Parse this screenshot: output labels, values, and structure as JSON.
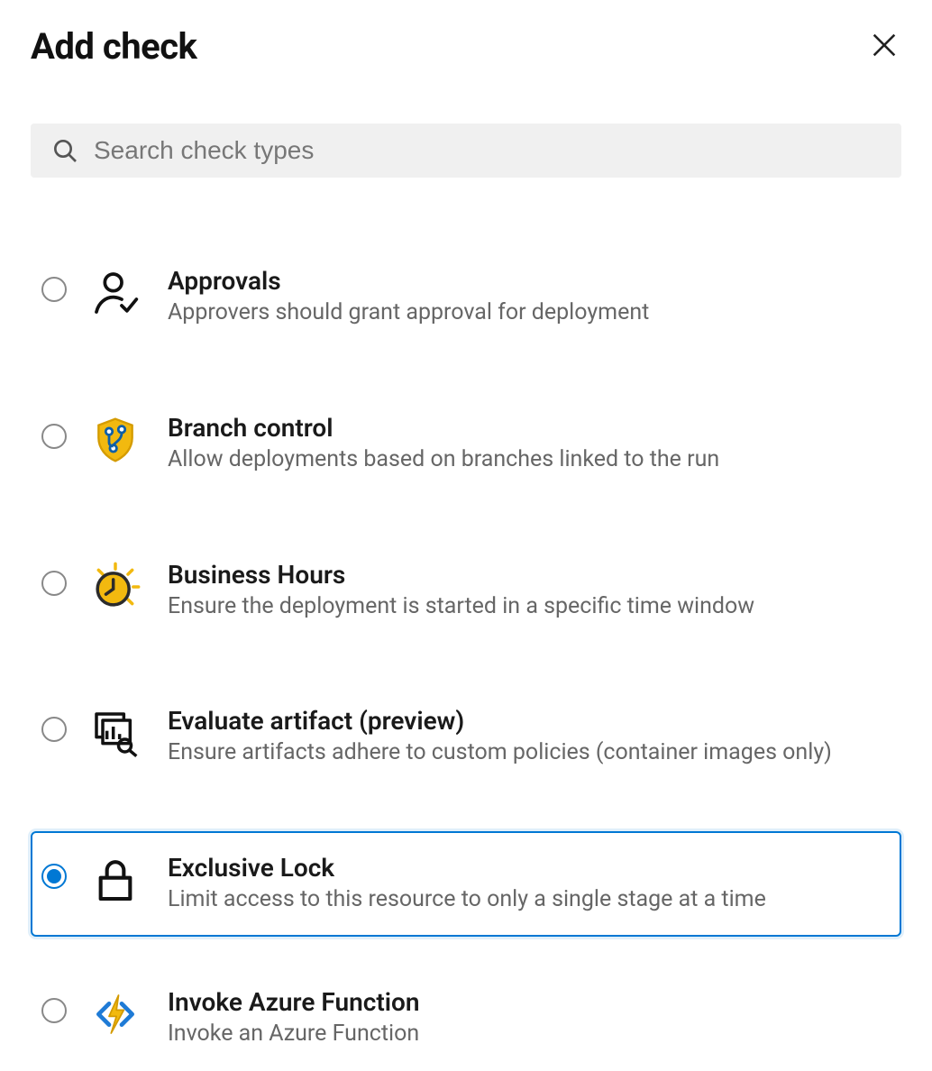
{
  "header": {
    "title": "Add check"
  },
  "search": {
    "placeholder": "Search check types",
    "value": ""
  },
  "checks": [
    {
      "id": "approvals",
      "title": "Approvals",
      "desc": "Approvers should grant approval for deployment",
      "selected": false,
      "icon": "person-check-icon"
    },
    {
      "id": "branch-control",
      "title": "Branch control",
      "desc": "Allow deployments based on branches linked to the run",
      "selected": false,
      "icon": "branch-shield-icon"
    },
    {
      "id": "business-hours",
      "title": "Business Hours",
      "desc": "Ensure the deployment is started in a specific time window",
      "selected": false,
      "icon": "clock-sun-icon"
    },
    {
      "id": "evaluate-artifact",
      "title": "Evaluate artifact (preview)",
      "desc": "Ensure artifacts adhere to custom policies (container images only)",
      "selected": false,
      "icon": "artifact-search-icon"
    },
    {
      "id": "exclusive-lock",
      "title": "Exclusive Lock",
      "desc": "Limit access to this resource to only a single stage at a time",
      "selected": true,
      "icon": "lock-icon"
    },
    {
      "id": "invoke-azure-function",
      "title": "Invoke Azure Function",
      "desc": "Invoke an Azure Function",
      "selected": false,
      "icon": "azure-function-icon"
    }
  ]
}
